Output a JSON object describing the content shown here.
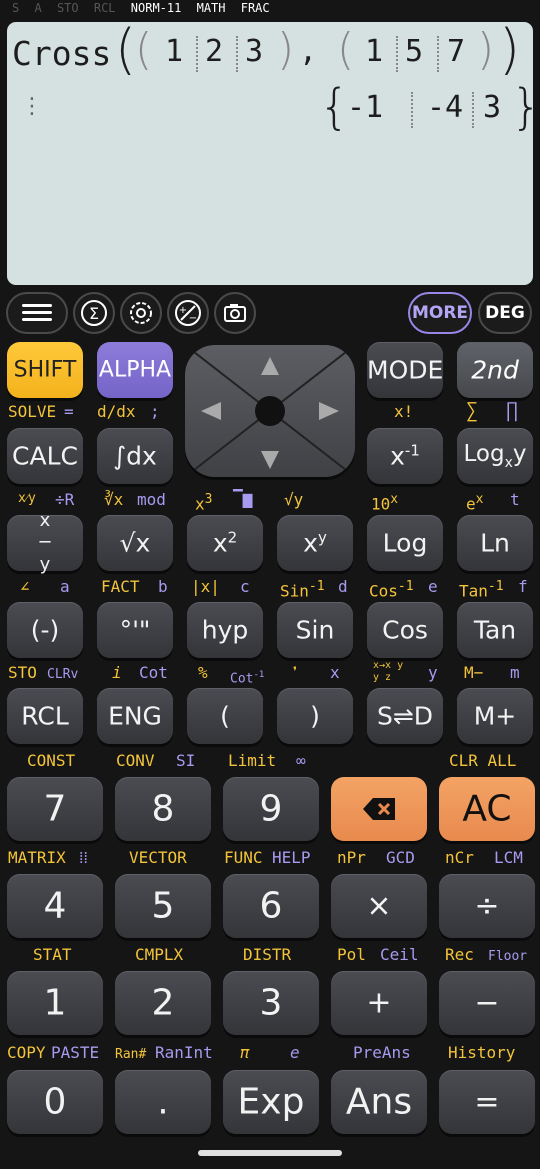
{
  "status": {
    "indicators": [
      "S",
      "A",
      "STO",
      "RCL"
    ],
    "mode": "NORM-11",
    "math": "MATH",
    "frac": "FRAC"
  },
  "display": {
    "func": "Cross",
    "vec1": [
      "1",
      "2",
      "3"
    ],
    "vec2": [
      "1",
      "5",
      "7"
    ],
    "comma": ",",
    "result": [
      "-1",
      "-4",
      "3"
    ],
    "more_indicator": "⋮"
  },
  "toolbar": {
    "more": "MORE",
    "deg": "DEG",
    "icons": [
      "menu-icon",
      "sigma-icon",
      "gear-icon",
      "plus-minus-icon",
      "camera-icon"
    ]
  },
  "row1": {
    "shift": "SHIFT",
    "alpha": "ALPHA",
    "mode": "MODE",
    "second": "2nd"
  },
  "row1_labels": {
    "solve": "SOLVE",
    "eq": "=",
    "ddx": "d/dx",
    "semi": ";",
    "xfact": "x!",
    "sum": "∑",
    "prod": "∏"
  },
  "row2": {
    "calc": "CALC",
    "integral": "∫dx",
    "xinv": "x",
    "xinv_sup": "-1",
    "logxy": "Log",
    "logxy_sub": "x",
    "logxy_y": "y"
  },
  "row2_labels": {
    "frac_r": "÷R",
    "cbrt_mod": "mod",
    "x3": "x",
    "x3_sup": "3",
    "nthroot": "√y",
    "pow10": "10",
    "pow10_sup": "x",
    "ex": "e",
    "ex_sup": "x",
    "t": "t"
  },
  "row3": {
    "frac": "x/y",
    "sqrt": "√x",
    "sq": "x",
    "sq_sup": "2",
    "pow": "x",
    "pow_sup": "y",
    "log": "Log",
    "ln": "Ln"
  },
  "row3_labels": {
    "angle": "∠",
    "a": "a",
    "fact": "FACT",
    "b": "b",
    "abs": "|x|",
    "c": "c",
    "sininv": "Sin",
    "d": "d",
    "cosinv": "Cos",
    "e": "e",
    "taninv": "Tan",
    "f": "f",
    "inv_sup": "-1"
  },
  "row4": {
    "neg": "(-)",
    "dms": "°'\"",
    "hyp": "hyp",
    "sin": "Sin",
    "cos": "Cos",
    "tan": "Tan"
  },
  "row4_labels": {
    "sto": "STO",
    "clrv": "CLRv",
    "i": "i",
    "cot": "Cot",
    "pct": "%",
    "cotinv": "Cot",
    "cotinv_sup": "-1",
    "comma": "❜",
    "x": "x",
    "conv": "x/y→x/z",
    "yv": "y",
    "mminus": "M−",
    "m": "m"
  },
  "row5": {
    "rcl": "RCL",
    "eng": "ENG",
    "lparen": "(",
    "rparen": ")",
    "sd": "S⇌D",
    "mplus": "M+"
  },
  "row5_labels": {
    "const": "CONST",
    "conv": "CONV",
    "si": "SI",
    "limit": "Limit",
    "inf": "∞",
    "clrall": "CLR ALL"
  },
  "num_row1": {
    "seven": "7",
    "eight": "8",
    "nine": "9",
    "ac": "AC"
  },
  "num_row1_labels": {
    "matrix": "MATRIX",
    "vector": "VECTOR",
    "func": "FUNC",
    "help": "HELP",
    "npr": "nPr",
    "gcd": "GCD",
    "ncr": "nCr",
    "lcm": "LCM"
  },
  "num_row2": {
    "four": "4",
    "five": "5",
    "six": "6",
    "mul": "×",
    "div": "÷"
  },
  "num_row2_labels": {
    "stat": "STAT",
    "cmplx": "CMPLX",
    "distr": "DISTR",
    "pol": "Pol",
    "ceil": "Ceil",
    "rec": "Rec",
    "floor": "Floor"
  },
  "num_row3": {
    "one": "1",
    "two": "2",
    "three": "3",
    "plus": "+",
    "minus": "−"
  },
  "num_row3_labels": {
    "copy": "COPY",
    "paste": "PASTE",
    "ranhash": "Ran#",
    "ranint": "RanInt",
    "pi": "π",
    "e": "e",
    "preans": "PreAns",
    "history": "History"
  },
  "num_row4": {
    "zero": "0",
    "dot": ".",
    "exp": "Exp",
    "ans": "Ans",
    "eq": "="
  },
  "colors": {
    "display_bg": "#d5e1e0",
    "shift": "#f3b21c",
    "alpha": "#7564c8",
    "orange": "#e88a4e",
    "yellow_label": "#f3c43a",
    "purple_label": "#a69bf0"
  }
}
